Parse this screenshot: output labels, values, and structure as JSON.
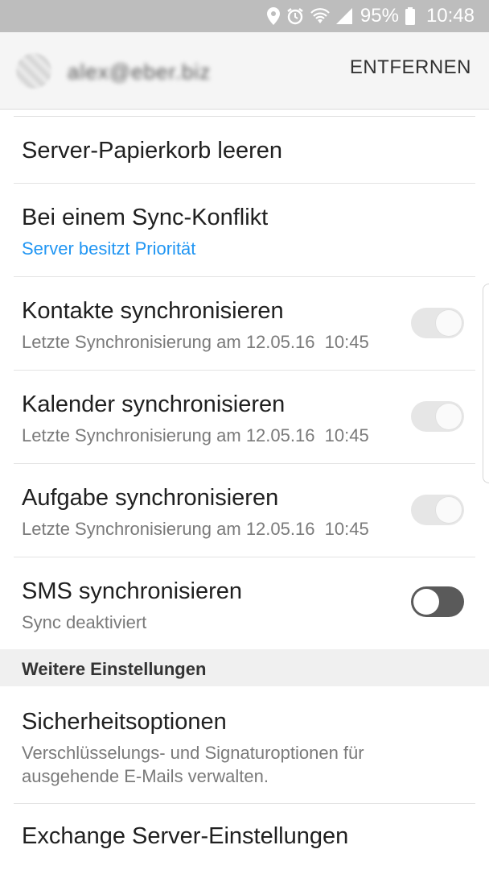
{
  "status_bar": {
    "battery": "95%",
    "time": "10:48",
    "icons": [
      "location-icon",
      "alarm-icon",
      "wifi-icon",
      "signal-icon",
      "battery-icon"
    ]
  },
  "header": {
    "account": "alex@eber.biz",
    "remove_label": "ENTFERNEN"
  },
  "items": [
    {
      "title": "Server-Papierkorb leeren"
    },
    {
      "title": "Bei einem Sync-Konflikt",
      "subtitle": "Server besitzt Priorität"
    },
    {
      "title": "Kontakte synchronisieren",
      "subtitle": "Letzte Synchronisierung am 12.05.16  10:45",
      "toggle": "on-disabled"
    },
    {
      "title": "Kalender synchronisieren",
      "subtitle": "Letzte Synchronisierung am 12.05.16  10:45",
      "toggle": "on-disabled"
    },
    {
      "title": "Aufgabe synchronisieren",
      "subtitle": "Letzte Synchronisierung am 12.05.16  10:45",
      "toggle": "on-disabled"
    },
    {
      "title": "SMS synchronisieren",
      "subtitle": "Sync deaktiviert",
      "toggle": "off"
    }
  ],
  "section": {
    "title": "Weitere Einstellungen"
  },
  "more_items": [
    {
      "title": "Sicherheitsoptionen",
      "subtitle_line1": "Verschlüsselungs- und Signaturoptionen für",
      "subtitle_line2": "ausgehende E-Mails verwalten."
    },
    {
      "title": "Exchange Server-Einstellungen"
    }
  ],
  "colors": {
    "accent": "#2196f3",
    "statusbar": "#bdbdbd"
  }
}
